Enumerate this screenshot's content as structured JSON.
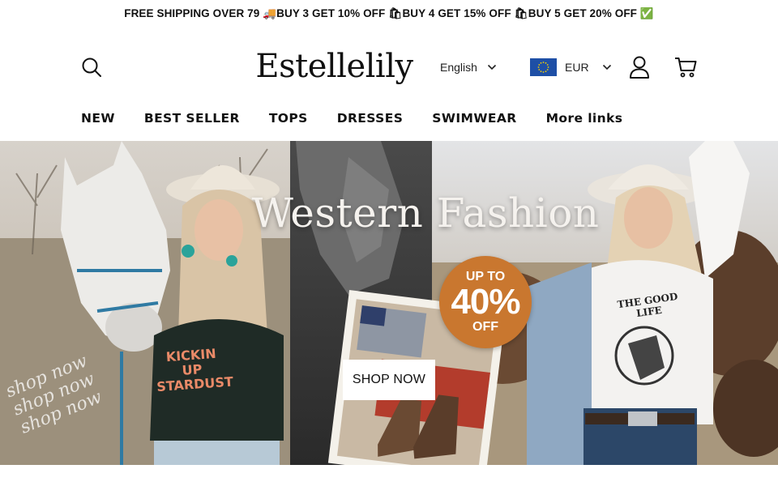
{
  "announcement": {
    "text": "FREE SHIPPING OVER 79 🚚BUY 3 GET 10% OFF 🛍BUY 4 GET 15% OFF 🛍BUY 5 GET 20% OFF ✅"
  },
  "header": {
    "logo": "Estellelily",
    "language": {
      "selected": "English"
    },
    "currency": {
      "selected": "EUR",
      "flag": "eu-flag"
    },
    "icons": [
      "search-icon",
      "user-icon",
      "cart-icon",
      "chevron-down-icon"
    ]
  },
  "nav": {
    "items": [
      "NEW",
      "BEST SELLER",
      "TOPS",
      "DRESSES",
      "SWIMWEAR",
      "More links"
    ]
  },
  "hero": {
    "title": "Western Fashion",
    "promo": {
      "top": "UP TO",
      "value": "40%",
      "bottom": "OFF"
    },
    "cta": "SHOP NOW",
    "script_text": [
      "shop now",
      "shop now",
      "shop now"
    ],
    "shirt_left": "KICKIN UP STARDUST",
    "shirt_right": "THE GOOD LIFE",
    "colors": {
      "promo_badge": "#c9772f",
      "sky": "#d9d6d0",
      "denim": "#8fa8c2"
    }
  }
}
